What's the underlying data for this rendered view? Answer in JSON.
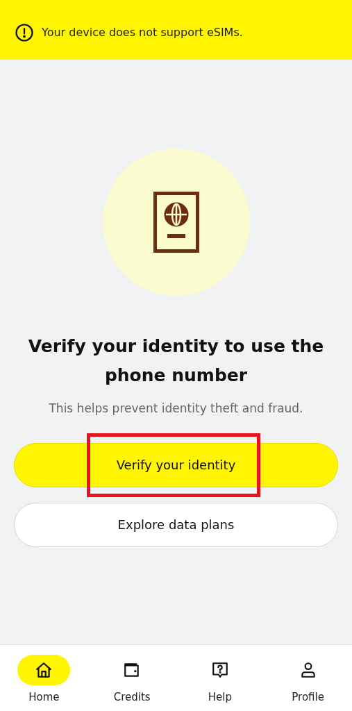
{
  "banner": {
    "message": "Your device does not support eSIMs."
  },
  "title": "Verify your identity to use the phone number",
  "subtitle": "This helps prevent identity theft and fraud.",
  "buttons": [
    {
      "label": "Verify your identity",
      "kind": "primary",
      "highlighted": true
    },
    {
      "label": "Explore data plans",
      "kind": "secondary",
      "highlighted": false
    }
  ],
  "nav": [
    {
      "label": "Home",
      "kind": "home",
      "selected": true
    },
    {
      "label": "Credits",
      "kind": "wallet",
      "selected": false
    },
    {
      "label": "Help",
      "kind": "help",
      "selected": false
    },
    {
      "label": "Profile",
      "kind": "profile",
      "selected": false
    }
  ]
}
